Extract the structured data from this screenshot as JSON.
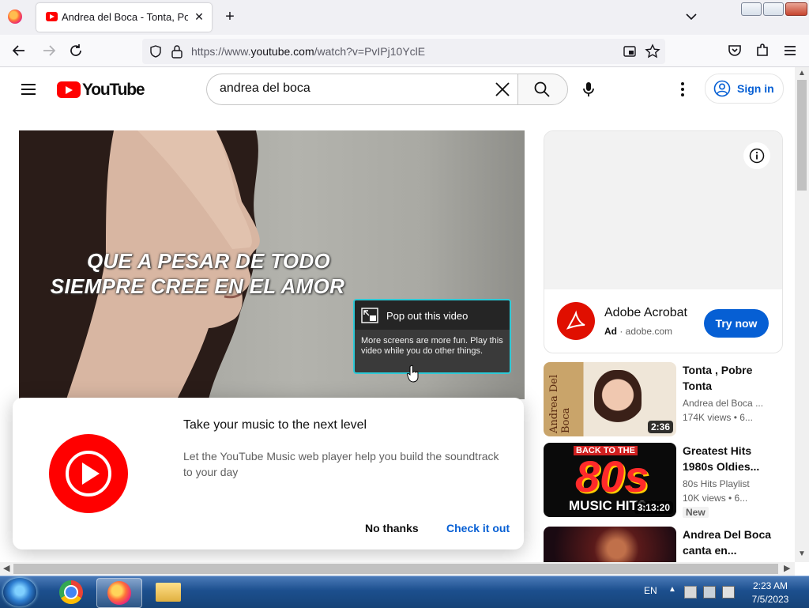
{
  "browser": {
    "tab_title": "Andrea del Boca - Tonta, Pobre Tonta - YouTube",
    "url_prefix": "https://www.",
    "url_domain": "youtube.com",
    "url_path": "/watch?v=PvIPj10YclE"
  },
  "yt": {
    "logo_text": "YouTube",
    "search_value": "andrea del boca",
    "sign_in": "Sign in"
  },
  "player": {
    "subtitle_line1": "QUE A PESAR DE TODO",
    "subtitle_line2": "SIEMPRE CREE EN EL AMOR"
  },
  "popout": {
    "title": "Pop out this video",
    "body": "More screens are more fun. Play this video while you do other things."
  },
  "promo": {
    "title": "Take your music to the next level",
    "body": "Let the YouTube Music web player help you build the soundtrack to your day",
    "dismiss": "No thanks",
    "accept": "Check it out"
  },
  "ad": {
    "advertiser": "Adobe Acrobat",
    "label": "Ad",
    "domain": "adobe.com",
    "cta": "Try now"
  },
  "recs": [
    {
      "title": "Tonta , Pobre Tonta",
      "channel": "Andrea del Boca ...",
      "stats": "174K views  • 6...",
      "duration": "2:36",
      "thumb_text": "Andrea Del Boca"
    },
    {
      "title": "Greatest Hits 1980s Oldies...",
      "channel": "80s Hits Playlist",
      "stats": "10K views  • 6...",
      "duration": "3:13:20",
      "badge": "New",
      "thumb_top": "BACK TO THE",
      "thumb_big": "80s",
      "thumb_bottom": "MUSIC HITS"
    },
    {
      "title": "Andrea Del Boca canta en..."
    }
  ],
  "taskbar": {
    "lang": "EN",
    "time": "2:23 AM",
    "date": "7/5/2023"
  }
}
